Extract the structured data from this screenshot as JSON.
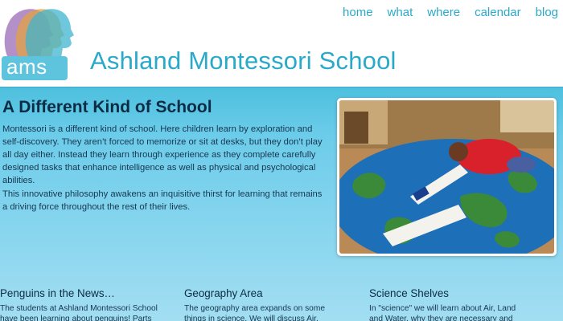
{
  "header": {
    "logo_text": "ams",
    "school_name": "Ashland Montessori School"
  },
  "nav": {
    "items": [
      "home",
      "what",
      "where",
      "calendar",
      "blog"
    ]
  },
  "intro": {
    "title": "A Different Kind of School",
    "paragraph1": "Montessori is a different kind of school. Here children learn by exploration and self-discovery. They aren’t forced to memorize or sit at desks, but they don’t play all day either. Instead they learn through experience as they complete carefully designed tasks that enhance intelligence as well as physical and psychological abilities.",
    "paragraph2": "This innovative philosophy awakens an inquisitive thirst for learning that remains a driving force throughout the rest of their lives."
  },
  "columns": [
    {
      "title": "Penguins in the News…",
      "text": "The students at Ashland Montessori School have been learning about penguins!  Parts"
    },
    {
      "title": "Geography Area",
      "text": "The geography area expands on some things in  science. We will discuss Air, Land"
    },
    {
      "title": "Science Shelves",
      "text": "In \"science\" we will learn about Air, Land and Water, why they are necessary and"
    }
  ],
  "colors": {
    "brand": "#2aa9c9",
    "band_top": "#4dc0de",
    "band_bottom": "#a3def2",
    "heading": "#0c2c44"
  }
}
